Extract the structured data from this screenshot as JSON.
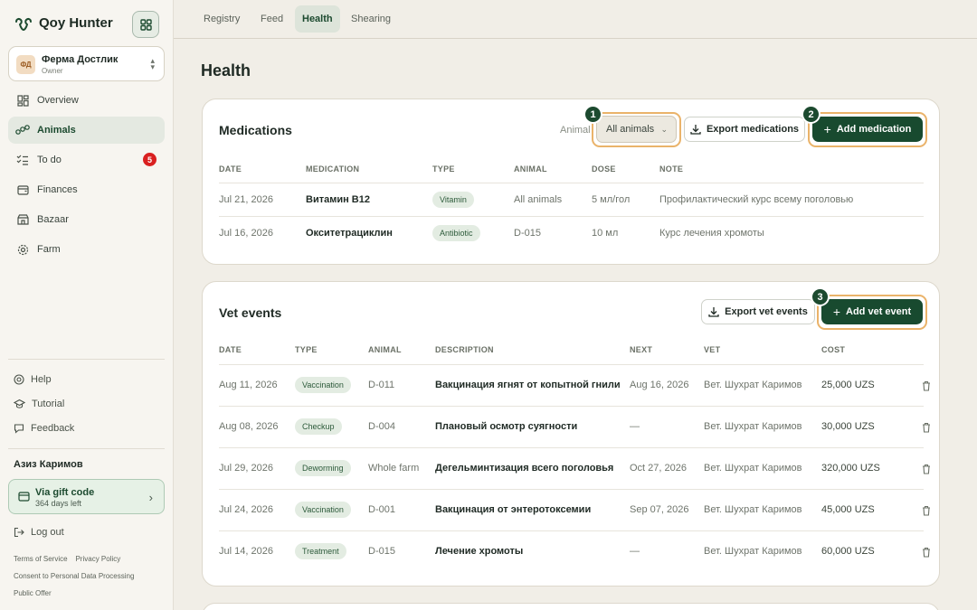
{
  "app": {
    "name": "Qoy Hunter"
  },
  "farm": {
    "initials": "ФД",
    "name": "Ферма Достлик",
    "role": "Owner"
  },
  "nav": [
    {
      "label": "Overview",
      "icon": "overview-icon"
    },
    {
      "label": "Animals",
      "icon": "animals-icon",
      "active": true
    },
    {
      "label": "To do",
      "icon": "todo-icon",
      "badge": "5"
    },
    {
      "label": "Finances",
      "icon": "finances-icon"
    },
    {
      "label": "Bazaar",
      "icon": "bazaar-icon"
    },
    {
      "label": "Farm",
      "icon": "gear-icon"
    }
  ],
  "help": {
    "help": "Help",
    "tutorial": "Tutorial",
    "feedback": "Feedback"
  },
  "user": {
    "name": "Азиз Каримов"
  },
  "gift": {
    "title": "Via gift code",
    "sub": "364 days left"
  },
  "logout": "Log out",
  "footer": {
    "terms": "Terms of Service",
    "privacy": "Privacy Policy",
    "consent": "Consent to Personal Data Processing",
    "offer": "Public Offer"
  },
  "tabs": [
    "Registry",
    "Feed",
    "Health",
    "Shearing"
  ],
  "page": {
    "title": "Health"
  },
  "medications": {
    "title": "Medications",
    "filter_label": "Animal",
    "filter_value": "All animals",
    "export": "Export medications",
    "add": "Add medication",
    "headers": [
      "DATE",
      "MEDICATION",
      "TYPE",
      "ANIMAL",
      "DOSE",
      "NOTE"
    ],
    "rows": [
      {
        "date": "Jul 21, 2026",
        "med": "Витамин B12",
        "type": "Vitamin",
        "animal": "All animals",
        "dose": "5 мл/гол",
        "note": "Профилактический курс всему поголовью"
      },
      {
        "date": "Jul 16, 2026",
        "med": "Окситетрациклин",
        "type": "Antibiotic",
        "animal": "D-015",
        "dose": "10 мл",
        "note": "Курс лечения хромоты"
      }
    ]
  },
  "vet": {
    "title": "Vet events",
    "export": "Export vet events",
    "add": "Add vet event",
    "headers": [
      "DATE",
      "TYPE",
      "ANIMAL",
      "DESCRIPTION",
      "NEXT",
      "VET",
      "COST"
    ],
    "rows": [
      {
        "date": "Aug 11, 2026",
        "type": "Vaccination",
        "animal": "D-011",
        "desc": "Вакцинация ягнят от копытной гнили",
        "next": "Aug 16, 2026",
        "vet": "Вет. Шухрат Каримов",
        "cost": "25,000 UZS"
      },
      {
        "date": "Aug 08, 2026",
        "type": "Checkup",
        "animal": "D-004",
        "desc": "Плановый осмотр суягности",
        "next": "—",
        "vet": "Вет. Шухрат Каримов",
        "cost": "30,000 UZS"
      },
      {
        "date": "Jul 29, 2026",
        "type": "Deworming",
        "animal": "Whole farm",
        "desc": "Дегельминтизация всего поголовья",
        "next": "Oct 27, 2026",
        "vet": "Вет. Шухрат Каримов",
        "cost": "320,000 UZS"
      },
      {
        "date": "Jul 24, 2026",
        "type": "Vaccination",
        "animal": "D-001",
        "desc": "Вакцинация от энтеротоксемии",
        "next": "Sep 07, 2026",
        "vet": "Вет. Шухрат Каримов",
        "cost": "45,000 UZS"
      },
      {
        "date": "Jul 14, 2026",
        "type": "Treatment",
        "animal": "D-015",
        "desc": "Лечение хромоты",
        "next": "—",
        "vet": "Вет. Шухрат Каримов",
        "cost": "60,000 UZS"
      }
    ]
  },
  "markers": [
    "1",
    "2",
    "3"
  ],
  "colors": {
    "accent": "#184a2f",
    "highlight": "#eab36a",
    "badge": "#d92020"
  }
}
